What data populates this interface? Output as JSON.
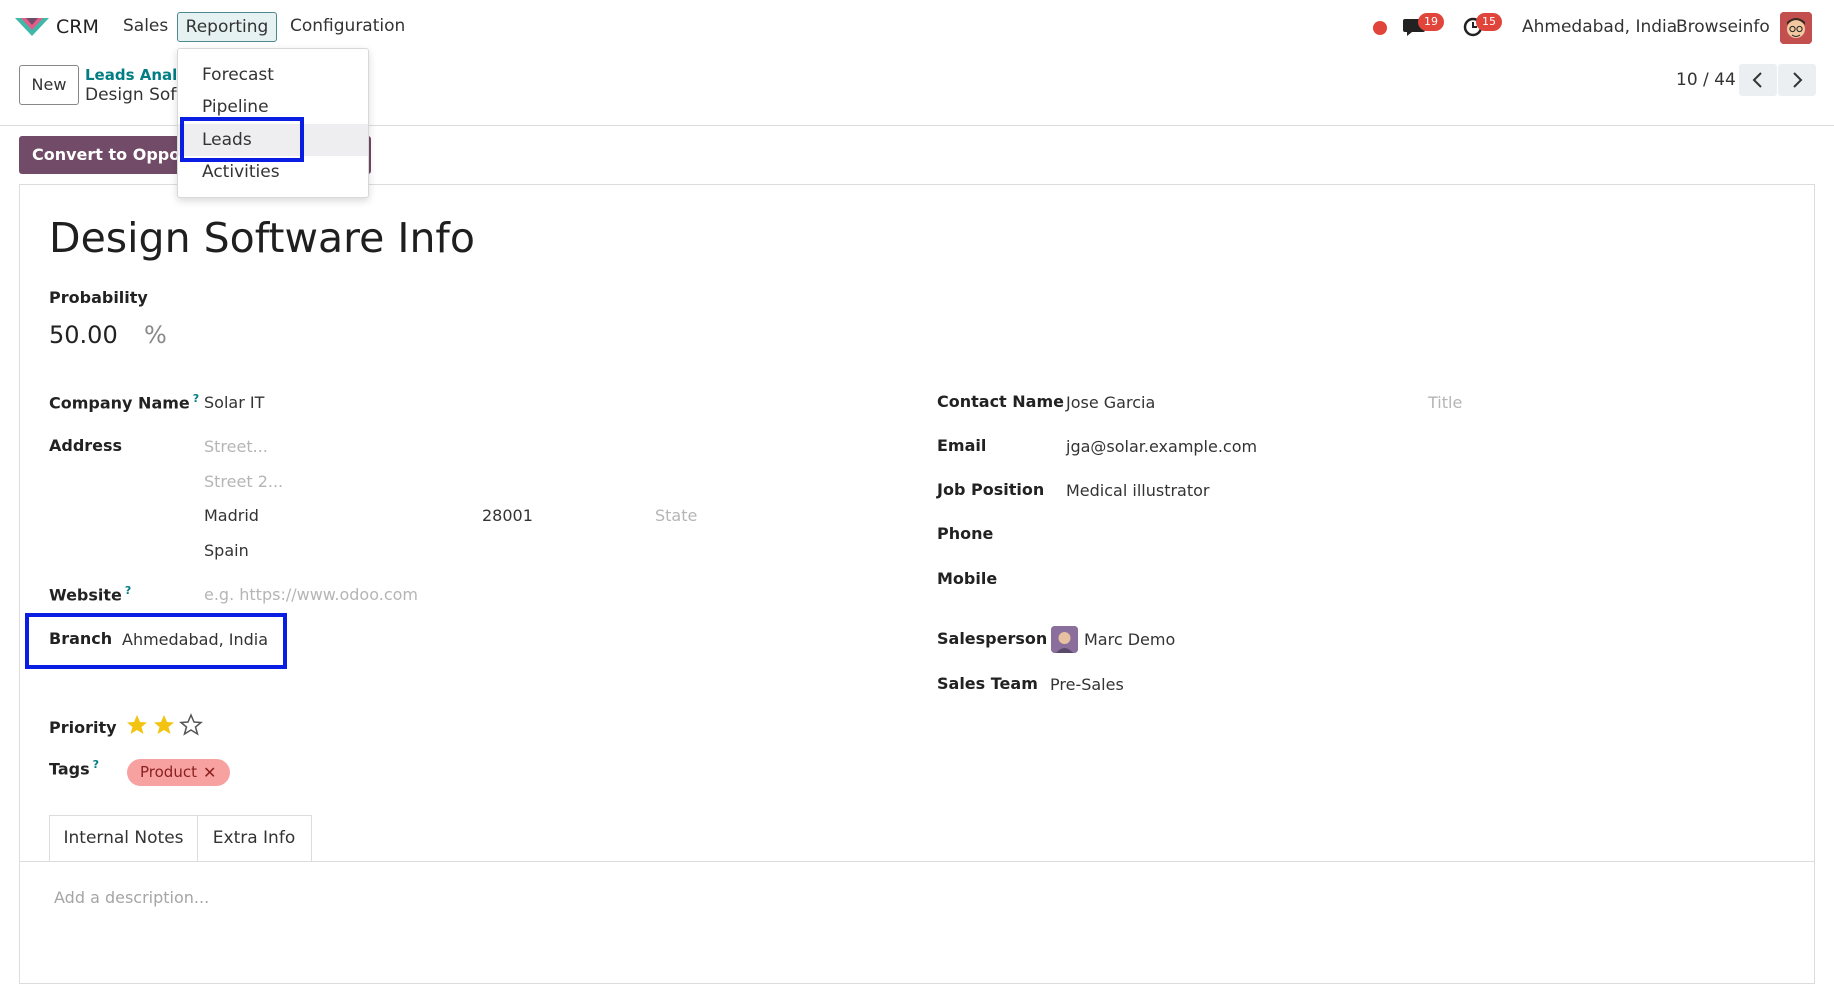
{
  "navbar": {
    "app_name": "CRM",
    "menus": [
      "Sales",
      "Reporting",
      "Configuration"
    ],
    "messages_count": "19",
    "activities_count": "15",
    "branch": "Ahmedabad, India",
    "company": "Browseinfo"
  },
  "control_panel": {
    "new_label": "New",
    "breadcrumb_parent": "Leads Analysis",
    "breadcrumb_current": "Design Software Info",
    "pager": "10 / 44"
  },
  "reporting_menu": {
    "items": [
      "Forecast",
      "Pipeline",
      "Leads",
      "Activities"
    ],
    "active": "Leads"
  },
  "actions": {
    "convert_label": "Convert to Opportunity"
  },
  "form": {
    "title": "Design Software Info",
    "probability_label": "Probability",
    "probability_value": "50.00",
    "probability_unit": "%",
    "company_name_label": "Company Name",
    "company_name": "Solar IT",
    "address_label": "Address",
    "street_placeholder": "Street...",
    "street2_placeholder": "Street 2...",
    "city": "Madrid",
    "zip": "28001",
    "state_placeholder": "State",
    "country": "Spain",
    "website_label": "Website",
    "website_placeholder": "e.g. https://www.odoo.com",
    "branch_label": "Branch",
    "branch_value": "Ahmedabad, India",
    "priority_label": "Priority",
    "priority_stars": 2,
    "priority_max": 3,
    "tags_label": "Tags",
    "tags": [
      "Product"
    ],
    "contact_name_label": "Contact Name",
    "contact_name": "Jose Garcia",
    "title_placeholder": "Title",
    "email_label": "Email",
    "email": "jga@solar.example.com",
    "job_position_label": "Job Position",
    "job_position": "Medical illustrator",
    "phone_label": "Phone",
    "mobile_label": "Mobile",
    "salesperson_label": "Salesperson",
    "salesperson": "Marc Demo",
    "sales_team_label": "Sales Team",
    "sales_team": "Pre-Sales"
  },
  "tabs": {
    "items": [
      "Internal Notes",
      "Extra Info"
    ],
    "active": "Internal Notes",
    "description_placeholder": "Add a description..."
  },
  "colors": {
    "primary": "#714b67",
    "link": "#017e84",
    "highlight": "#0a1ee3",
    "badge": "#e0443a",
    "star": "#f3c311",
    "tag_bg": "#f7a2a0"
  }
}
